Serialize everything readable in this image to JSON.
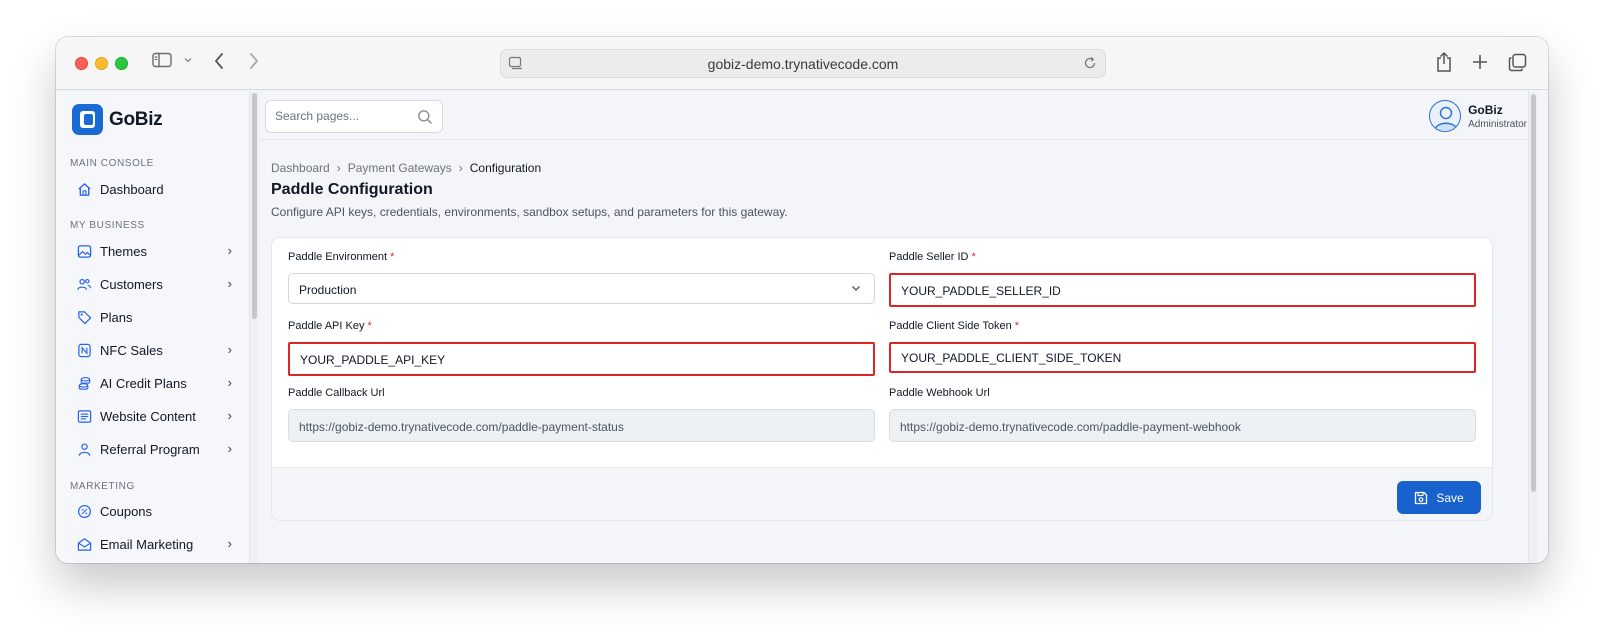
{
  "browser": {
    "url": "gobiz-demo.trynativecode.com"
  },
  "sidebar": {
    "brand": "GoBiz",
    "sections": {
      "main_console": "MAIN CONSOLE",
      "my_business": "MY BUSINESS",
      "marketing": "MARKETING"
    },
    "items": [
      {
        "label": "Dashboard",
        "icon": "home-icon",
        "has_submenu": false
      },
      {
        "label": "Themes",
        "icon": "image-icon",
        "has_submenu": true
      },
      {
        "label": "Customers",
        "icon": "users-icon",
        "has_submenu": true
      },
      {
        "label": "Plans",
        "icon": "tag-icon",
        "has_submenu": false
      },
      {
        "label": "NFC Sales",
        "icon": "nfc-icon",
        "has_submenu": true
      },
      {
        "label": "AI Credit Plans",
        "icon": "coins-icon",
        "has_submenu": true
      },
      {
        "label": "Website Content",
        "icon": "document-icon",
        "has_submenu": true
      },
      {
        "label": "Referral Program",
        "icon": "user-icon",
        "has_submenu": true
      },
      {
        "label": "Coupons",
        "icon": "percent-icon",
        "has_submenu": false
      },
      {
        "label": "Email Marketing",
        "icon": "mail-icon",
        "has_submenu": true
      }
    ],
    "chevron": "›"
  },
  "header": {
    "search_placeholder": "Search pages...",
    "user_name": "GoBiz",
    "user_role": "Administrator"
  },
  "breadcrumb": {
    "items": [
      "Dashboard",
      "Payment Gateways",
      "Configuration"
    ],
    "separator": "›"
  },
  "page": {
    "title": "Paddle Configuration",
    "subtitle": "Configure API keys, credentials, environments, sandbox setups, and parameters for this gateway."
  },
  "form": {
    "environment": {
      "label": "Paddle Environment",
      "required": "*",
      "value": "Production"
    },
    "seller_id": {
      "label": "Paddle Seller ID",
      "required": "*",
      "value": "YOUR_PADDLE_SELLER_ID"
    },
    "api_key": {
      "label": "Paddle API Key",
      "required": "*",
      "value": "YOUR_PADDLE_API_KEY"
    },
    "client_token": {
      "label": "Paddle Client Side Token",
      "required": "*",
      "value": "YOUR_PADDLE_CLIENT_SIDE_TOKEN"
    },
    "callback_url": {
      "label": "Paddle Callback Url",
      "value": "https://gobiz-demo.trynativecode.com/paddle-payment-status"
    },
    "webhook_url": {
      "label": "Paddle Webhook Url",
      "value": "https://gobiz-demo.trynativecode.com/paddle-payment-webhook"
    },
    "save_label": "Save"
  },
  "colors": {
    "accent": "#1762cc",
    "error": "#dc2626"
  }
}
